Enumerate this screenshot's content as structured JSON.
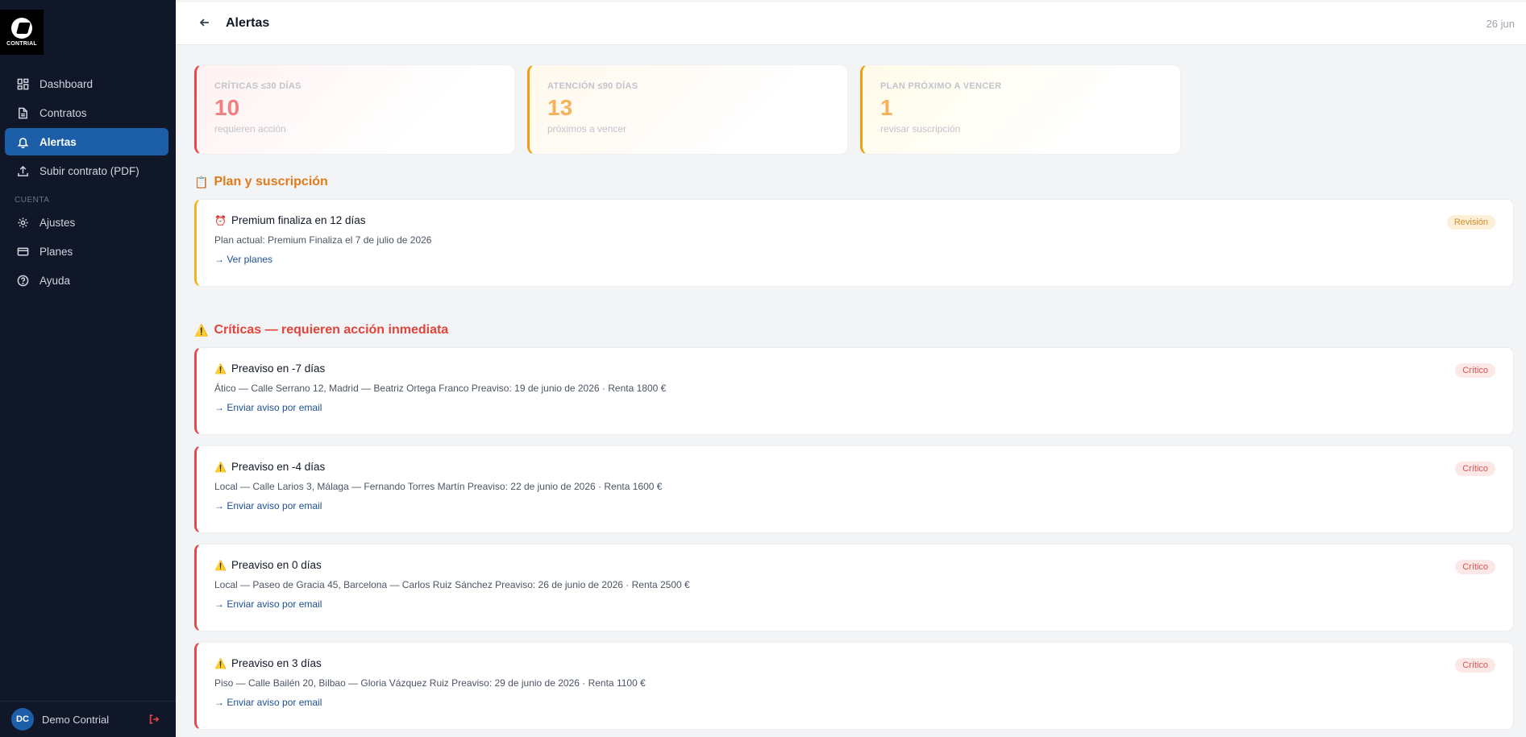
{
  "app": {
    "logo_text": "CONTRIAL"
  },
  "sidebar": {
    "items": [
      {
        "label": "Dashboard",
        "icon": "grid-icon"
      },
      {
        "label": "Contratos",
        "icon": "document-icon"
      },
      {
        "label": "Alertas",
        "icon": "bell-icon",
        "active": true
      },
      {
        "label": "Subir contrato (PDF)",
        "icon": "upload-icon"
      }
    ],
    "section_label": "CUENTA",
    "account_items": [
      {
        "label": "Ajustes",
        "icon": "gear-icon"
      },
      {
        "label": "Planes",
        "icon": "card-icon"
      },
      {
        "label": "Ayuda",
        "icon": "help-icon"
      }
    ],
    "user": {
      "initials": "DC",
      "name": "Demo Contrial"
    }
  },
  "header": {
    "title": "Alertas",
    "date": "26 jun"
  },
  "stats": [
    {
      "label": "CRÍTICAS ≤30 DÍAS",
      "value": "10",
      "sub": "requieren acción"
    },
    {
      "label": "ATENCIÓN ≤90 DÍAS",
      "value": "13",
      "sub": "próximos a vencer"
    },
    {
      "label": "PLAN PRÓXIMO A VENCER",
      "value": "1",
      "sub": "revisar suscripción"
    }
  ],
  "plan_section": {
    "emoji": "📋",
    "title": "Plan y suscripción",
    "card": {
      "emoji": "⏰",
      "title": "Premium finaliza en 12 días",
      "desc": "Plan actual: Premium Finaliza el 7 de julio de 2026",
      "link": "→ Ver planes",
      "badge": "Revisión"
    }
  },
  "critical_section": {
    "emoji": "⚠️",
    "title": "Críticas — requieren acción inmediata",
    "cards": [
      {
        "title": "Preaviso en -7 días",
        "desc": "Ático — Calle Serrano 12, Madrid — Beatriz Ortega Franco Preaviso: 19 de junio de 2026 · Renta 1800 €",
        "link": "→ Enviar aviso por email",
        "badge": "Crítico"
      },
      {
        "title": "Preaviso en -4 días",
        "desc": "Local — Calle Larios 3, Málaga — Fernando Torres Martín Preaviso: 22 de junio de 2026 · Renta 1600 €",
        "link": "→ Enviar aviso por email",
        "badge": "Crítico"
      },
      {
        "title": "Preaviso en 0 días",
        "desc": "Local — Paseo de Gracia 45, Barcelona — Carlos Ruiz Sánchez Preaviso: 26 de junio de 2026 · Renta 2500 €",
        "link": "→ Enviar aviso por email",
        "badge": "Crítico"
      },
      {
        "title": "Preaviso en 3 días",
        "desc": "Piso — Calle Bailén 20, Bilbao — Gloria Vázquez Ruiz Preaviso: 29 de junio de 2026 · Renta 1100 €",
        "link": "→ Enviar aviso por email",
        "badge": "Crítico"
      }
    ],
    "card_emoji": "⚠️"
  },
  "colors": {
    "sidebar_bg": "#0f1729",
    "active_nav": "#1d5ea8",
    "critical": "#e44848",
    "warning": "#f5b324"
  }
}
